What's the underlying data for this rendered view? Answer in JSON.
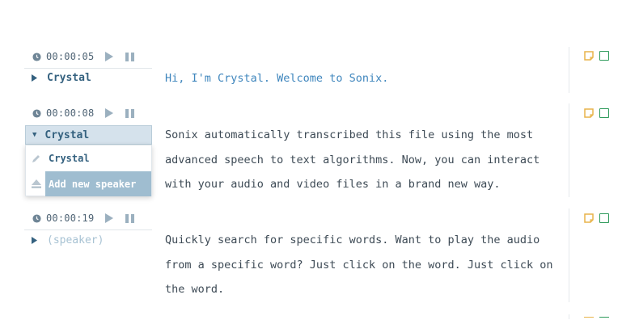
{
  "segments": [
    {
      "timestamp": "00:00:05",
      "speaker": "Crystal",
      "text": "Hi, I'm Crystal. Welcome to Sonix."
    },
    {
      "timestamp": "00:00:08",
      "speaker": "Crystal",
      "text": "Sonix automatically transcribed this file using the most advanced speech to text algorithms. Now, you can interact with your audio and video files in a brand new way."
    },
    {
      "timestamp": "00:00:19",
      "speaker": "(speaker)",
      "text": "Quickly search for specific words. Want to play the audio from a specific word? Just click on the word. Just click on the word."
    }
  ],
  "speaker_dropdown": {
    "selected": "Crystal",
    "options": [
      "Crystal"
    ],
    "add_label": "Add new speaker"
  },
  "icons": {
    "clock": "clock-icon",
    "play": "play-icon",
    "pause": "pause-icon",
    "note": "note-icon",
    "check": "checkbox-icon",
    "pencil": "pencil-icon",
    "eject": "add-speaker-icon"
  },
  "colors": {
    "accent_blue": "#3f86bd",
    "speaker_blue": "#34617f",
    "note_orange": "#e8b44a",
    "check_green": "#2e9a5b"
  }
}
